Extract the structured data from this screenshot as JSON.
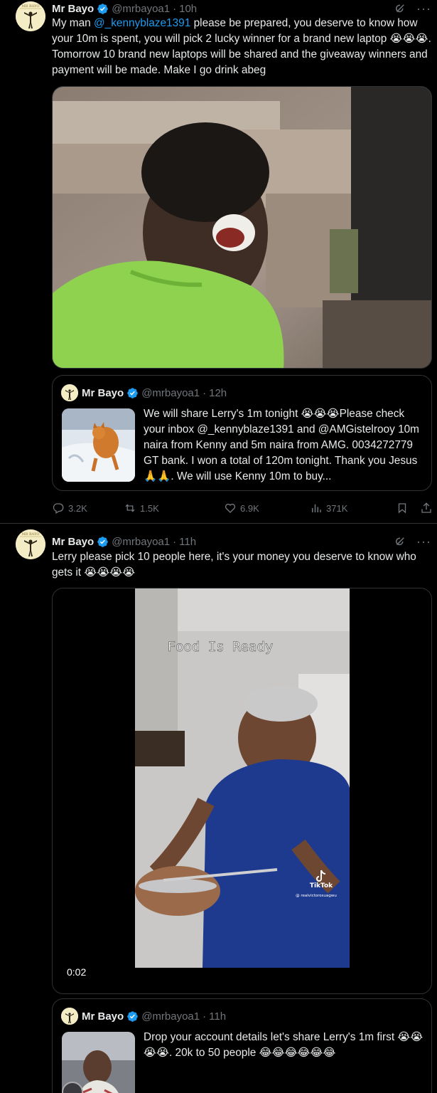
{
  "colors": {
    "background": "#000000",
    "text": "#e7e9ea",
    "muted": "#71767b",
    "link": "#1d9bf0",
    "verified": "#1d9bf0",
    "border": "#2f3336"
  },
  "tweets": [
    {
      "author": {
        "name": "Mr Bayo",
        "handle": "@mrbayoa1",
        "time": "10h",
        "avatar_text": "MR BAYO"
      },
      "text_before": "My man ",
      "mention": "@_kennyblaze1391",
      "text_after": " please be prepared, you deserve to know how your 10m is spent, you will pick 2 lucky winner for a brand new laptop 😭😭😭. Tomorrow 10 brand new laptops will be shared and the giveaway winners and payment will be made. Make I go drink abeg",
      "quote": {
        "author": {
          "name": "Mr Bayo",
          "handle": "@mrbayoa1",
          "time": "12h"
        },
        "text": "We will share Lerry's 1m tonight 😭😭😭Please check your inbox @_kennyblaze1391 and @AMGistelrooy 10m naira from Kenny and 5m naira from AMG. 0034272779 GT bank. I won a total of 120m tonight. Thank you Jesus 🙏🙏. We will use Kenny 10m to buy..."
      },
      "stats": {
        "replies": "3.2K",
        "reposts": "1.5K",
        "likes": "6.9K",
        "views": "371K"
      }
    },
    {
      "author": {
        "name": "Mr Bayo",
        "handle": "@mrbayoa1",
        "time": "11h",
        "avatar_text": "MR BAYO"
      },
      "text": "Lerry please pick 10 people here, it's your money you deserve to know who gets it 😭😭😭😭",
      "video": {
        "duration": "0:02",
        "caption": "Food Is Ready",
        "watermark": "TikTok",
        "watermark_handle": "@ realvictorosuagwu"
      },
      "quote": {
        "author": {
          "name": "Mr Bayo",
          "handle": "@mrbayoa1",
          "time": "11h"
        },
        "text": "Drop your account details let's share Lerry's 1m first 😭😭😭😭. 20k to 50 people 😂😂😂😂😂😂"
      }
    }
  ]
}
